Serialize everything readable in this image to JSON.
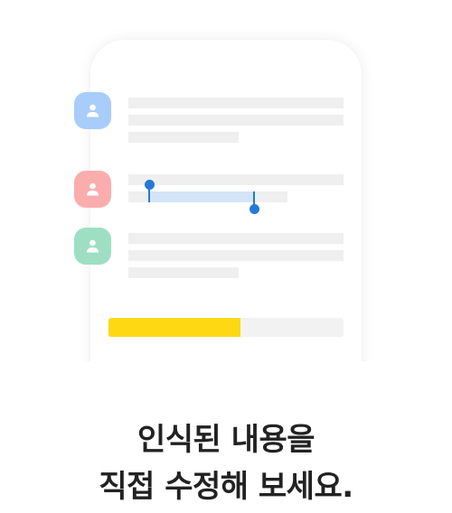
{
  "progress": {
    "value_percent": 56
  },
  "colors": {
    "avatar_blue": "#a8cdfb",
    "avatar_red": "#fbadae",
    "avatar_green": "#9edfc4",
    "selection_highlight": "#d4e5f9",
    "selection_handle": "#2479d6",
    "progress_fill": "#ffd814",
    "text": "#222222"
  },
  "icons": {
    "avatar": "person-icon"
  },
  "caption": {
    "line1": "인식된 내용을",
    "line2": "직접 수정해 보세요."
  }
}
